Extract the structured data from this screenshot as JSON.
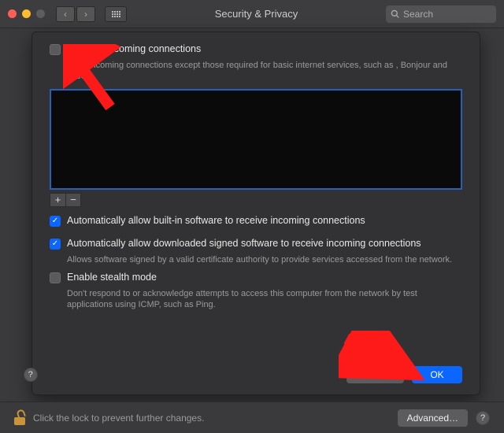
{
  "window": {
    "title": "Security & Privacy",
    "search_placeholder": "Search"
  },
  "options": {
    "block_all": {
      "checked": false,
      "label": "Block all incoming connections",
      "desc_partial": "ks all incoming connections except those required for basic internet services, such as , Bonjour and IPSec."
    },
    "allow_builtin": {
      "checked": true,
      "label": "Automatically allow built-in software to receive incoming connections"
    },
    "allow_signed": {
      "checked": true,
      "label": "Automatically allow downloaded signed software to receive incoming connections",
      "desc": "Allows software signed by a valid certificate authority to provide services accessed from the network."
    },
    "stealth": {
      "checked": false,
      "label": "Enable stealth mode",
      "desc": "Don't respond to or acknowledge attempts to access this computer from the network by test applications using ICMP, such as Ping."
    }
  },
  "buttons": {
    "add": "+",
    "remove": "−",
    "help": "?",
    "cancel": "Cancel",
    "ok": "OK",
    "advanced": "Advanced…"
  },
  "footer": {
    "lock_text": "Click the lock to prevent further changes."
  }
}
